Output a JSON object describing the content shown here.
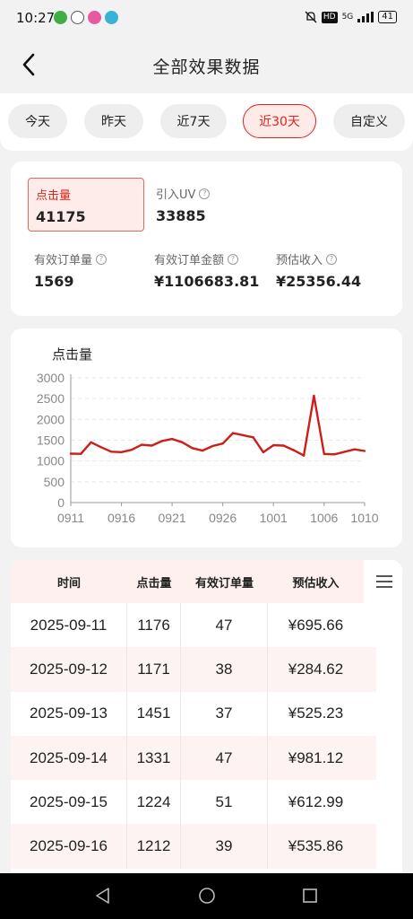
{
  "status_bar": {
    "time": "10:27",
    "network": "5G",
    "hd": "HD",
    "battery": "41"
  },
  "header": {
    "title": "全部效果数据"
  },
  "tabs": [
    {
      "label": "今天",
      "active": false
    },
    {
      "label": "昨天",
      "active": false
    },
    {
      "label": "近7天",
      "active": false
    },
    {
      "label": "近30天",
      "active": true
    },
    {
      "label": "自定义",
      "active": false
    }
  ],
  "metrics": [
    {
      "label": "点击量",
      "value": "41175",
      "selected": true,
      "help": false
    },
    {
      "label": "引入UV",
      "value": "33885",
      "selected": false,
      "help": true
    },
    {
      "label": "有效订单量",
      "value": "1569",
      "selected": false,
      "help": true
    },
    {
      "label": "有效订单金额",
      "value": "¥1106683.81",
      "selected": false,
      "help": true
    },
    {
      "label": "预估收入",
      "value": "¥25356.44",
      "selected": false,
      "help": true
    }
  ],
  "chart_data": {
    "type": "line",
    "title": "点击量",
    "x_tick_labels": [
      "0911",
      "0916",
      "0921",
      "0926",
      "1001",
      "1006",
      "1010"
    ],
    "y_tick_labels": [
      "0",
      "500",
      "1000",
      "1500",
      "2000",
      "2500",
      "3000"
    ],
    "ylim": [
      0,
      3000
    ],
    "grid": true,
    "color": "#cc1f1a",
    "series": [
      {
        "values": [
          1176,
          1171,
          1451,
          1331,
          1224,
          1212,
          1270,
          1390,
          1370,
          1480,
          1530,
          1450,
          1310,
          1250,
          1360,
          1420,
          1670,
          1620,
          1570,
          1210,
          1380,
          1370,
          1260,
          1130,
          2570,
          1170,
          1160,
          1220,
          1280,
          1240
        ]
      }
    ]
  },
  "table": {
    "headers": [
      "时间",
      "点击量",
      "有效订单量",
      "预估收入"
    ],
    "rows": [
      [
        "2025-09-11",
        "1176",
        "47",
        "¥695.66"
      ],
      [
        "2025-09-12",
        "1171",
        "38",
        "¥284.62"
      ],
      [
        "2025-09-13",
        "1451",
        "37",
        "¥525.23"
      ],
      [
        "2025-09-14",
        "1331",
        "47",
        "¥981.12"
      ],
      [
        "2025-09-15",
        "1224",
        "51",
        "¥612.99"
      ],
      [
        "2025-09-16",
        "1212",
        "39",
        "¥535.86"
      ]
    ]
  },
  "colors": {
    "accent": "#e2231a",
    "highlight_bg": "#fdecea",
    "row_alt": "#fdf3f2"
  }
}
